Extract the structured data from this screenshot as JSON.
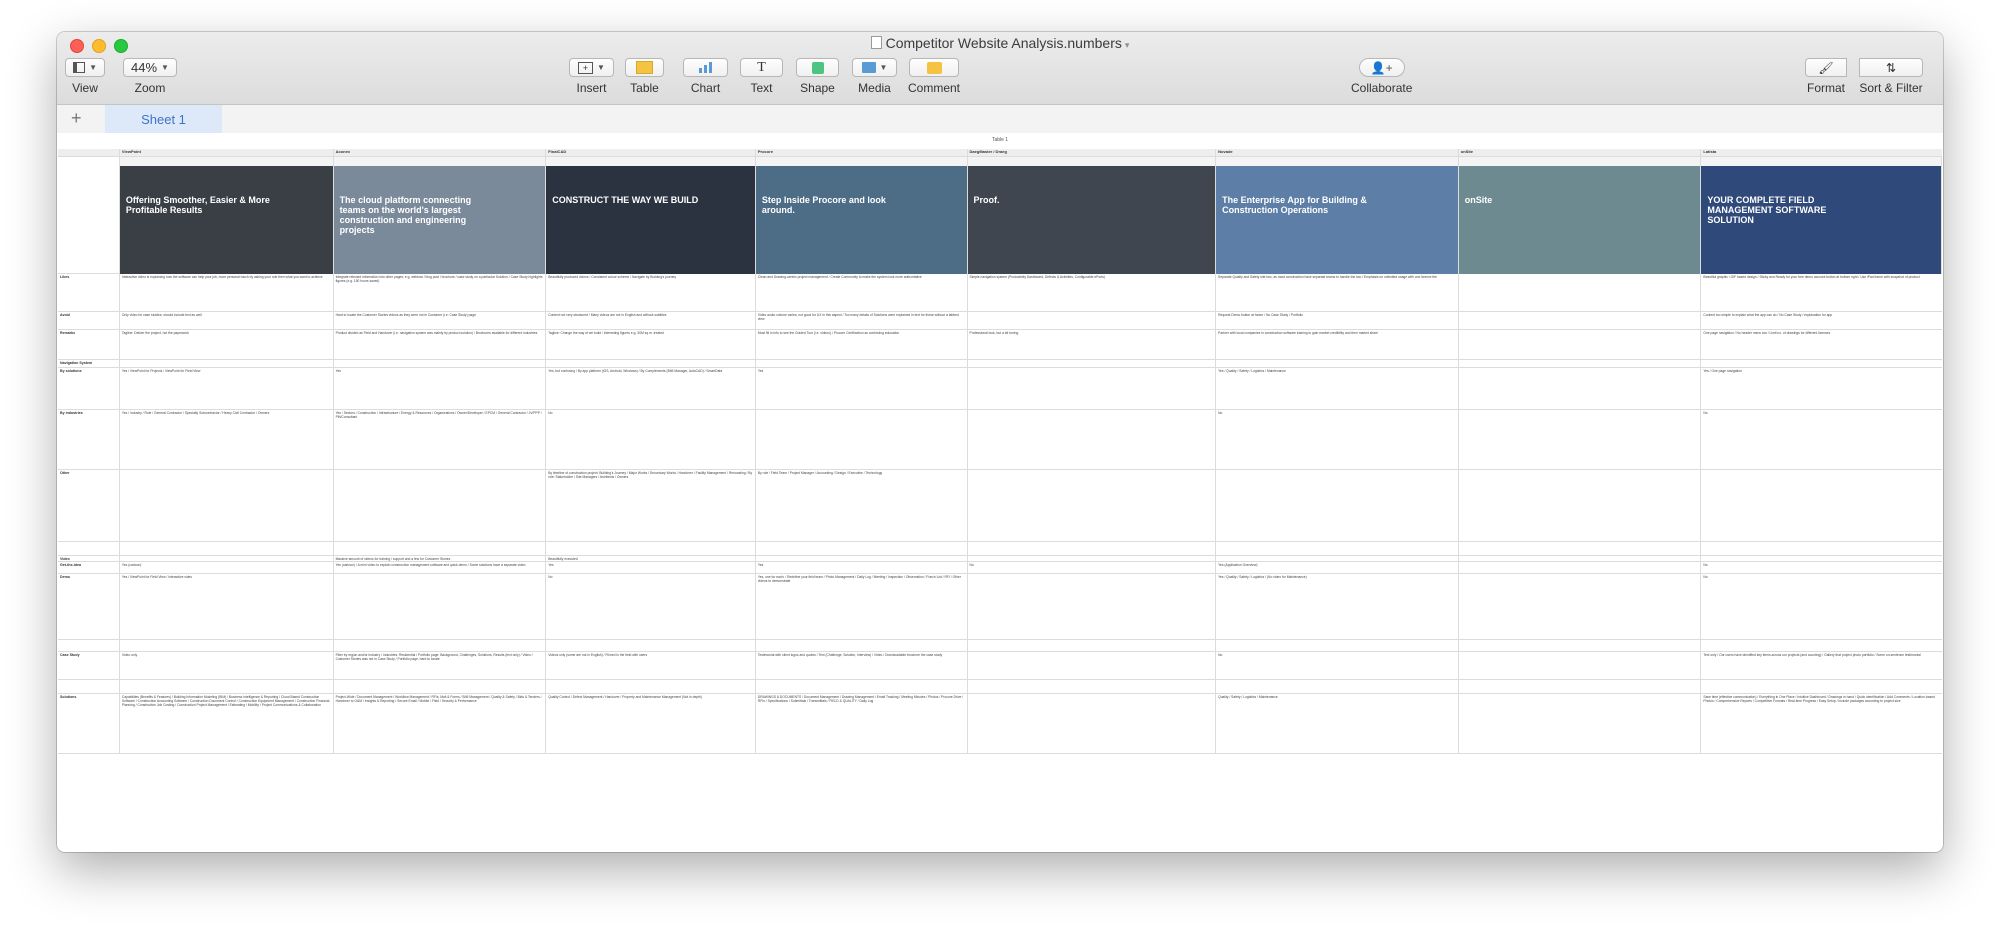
{
  "window": {
    "title": "Competitor Website Analysis.numbers"
  },
  "toolbar": {
    "view": "View",
    "zoom_label": "Zoom",
    "zoom_value": "44%",
    "insert": "Insert",
    "table": "Table",
    "chart": "Chart",
    "text": "Text",
    "shape": "Shape",
    "media": "Media",
    "comment": "Comment",
    "collaborate": "Collaborate",
    "format": "Format",
    "sort_filter": "Sort & Filter"
  },
  "sheet": {
    "tab": "Sheet 1",
    "table_title": "Table 1"
  },
  "colors": {
    "accent": "#3c74c8",
    "tab_bg": "#dde9f9",
    "insert_icon": "#f5c342",
    "shape_icon": "#4cc583",
    "media_icon": "#5b9bd5"
  },
  "columns": [
    "",
    "ViewPoint",
    "Aconex",
    "FinalCAD",
    "Procore",
    "DaegMaster / Draeg",
    "Novade",
    "onSite",
    "Latista"
  ],
  "screenshots": [
    {
      "text": "Offering Smoother, Easier & More Profitable Results",
      "color": "#3a3f46"
    },
    {
      "text": "The cloud platform connecting teams on the world's largest construction and engineering projects",
      "color": "#7a8a9a"
    },
    {
      "text": "CONSTRUCT THE WAY WE BUILD",
      "color": "#2b3340"
    },
    {
      "text": "Step Inside Procore and look around.",
      "color": "#4d6c86"
    },
    {
      "text": "Proof.",
      "color": "#3f4650"
    },
    {
      "text": "The Enterprise App for Building & Construction Operations",
      "color": "#5d7ea7"
    },
    {
      "text": "onSite",
      "color": "#6d8a90"
    },
    {
      "text": "YOUR COMPLETE FIELD MANAGEMENT SOFTWARE SOLUTION",
      "color": "#2f4a7a"
    }
  ],
  "rows": [
    {
      "label": "Likes",
      "cells": [
        "Interactive video is explaining how the software can help your job, more personal touch by asking your role then what you want to achieve",
        "Integrate relevant information into other pages; e.g. webinar / blog post / brochure / case study on a particular Solution / Case Study highlights figures (e.g. 150 hours saved)",
        "Beautifully produced videos / Consistent colour scheme / Navigate by Building's journey",
        "Clean and Drawing-centric project management / Create Community to make the system look more authoritative",
        "Simple navigation system (Productivity Dashboard, Defects & Activities, Configurable ePorts)",
        "Separate Quality and Safety site two, as most construction have separate teams to handle the two / Emphasis on unlimited usage with one licence fee",
        "",
        "Beautiful graphic / GIF based design / Sticky and Ready for your free demo account button at bottom right / Use iPad frame with snapshot of product",
        ""
      ]
    },
    {
      "label": "Avoid",
      "cells": [
        "Only video for case studies; should include text as well",
        "Hard to locate the Customer Stories videos as they were not in Customer (i.e. Case Study) page",
        "Content not very structured / Many videos are not in English and without subtitles",
        "Video audio volume varies; not good for UX in this aspect / Too many details of Solutions were explained in text for those without a tabbed view",
        "",
        "Request Demo button at footer / No Case Study / Portfolio",
        "",
        "Content too simple to explain what the app can do / No Case Study / explanation for app",
        "Text oriented content"
      ]
    },
    {
      "label": "Remarks",
      "cells": [
        "Tagline: Deliver the project, not the paperwork",
        "Product divided as Field and Handover (i.e. navigation system was mainly by product solution) / Brochures available for different industries",
        "Tagline: Change the way of we build / Interesting figures e.g. 30M sq.m. treated",
        "Must fill in info to see the Guided Tour (i.e. videos) / Procore Certification as continuing education",
        "Professional look, but a bit boring",
        "Partner with local companies in construction software training to gain market credibility and then market share",
        "",
        "One page navigation / No header menu bar / Limit no. of drawings for different licenses",
        ""
      ]
    },
    {
      "label": "Navigation System",
      "section": true,
      "cells": [
        "",
        "",
        "",
        "",
        "",
        "",
        "",
        "",
        ""
      ]
    },
    {
      "label": "By solutions",
      "cells": [
        "Yes / ViewPoint for Projects / ViewPoint for Field View",
        "Yes",
        "Yes, but confusing / By app platform (iOS, Android, Windows) / By Complements (BIM Manager, AutoCAD) / SmartData",
        "Yes",
        "",
        "Yes / Quality / Safety / Logistics / Maintenance",
        "",
        "Yes / One page navigation",
        "Yes / Features / Solutions"
      ]
    },
    {
      "label": "By industries",
      "cells": [
        "Yes / Industry / Role / General Contractor / Specialty Subcontractor / Heavy Civil Contractor / Owners",
        "Yes / Sectors / Construction / Infrastructure / Energy & Resources / Organizations / Owner/Developer / EPCM / General Contractor / JV/PPP / PM/Consultant",
        "No",
        "",
        "",
        "No",
        "",
        "No",
        ""
      ]
    },
    {
      "label": "Other",
      "cells": [
        "",
        "",
        "By timeline of construction project: Building's Journey / Major Works / Secondary Works / Handover / Facility Management / Renovating / By role: Stakeholder / Site Managers / Architects / Owners",
        "By role / Field Team / Project Manager / Accounting / Design / Executive / Technology",
        "",
        "",
        "",
        "",
        ""
      ]
    },
    {
      "label": "",
      "cells": [
        "",
        "",
        "",
        "",
        "",
        "",
        "",
        "",
        ""
      ]
    },
    {
      "label": "Video",
      "cells": [
        "",
        "Massive amount of videos for training / support and a few for Customer Stories",
        "Beautifully executed",
        "",
        "",
        "",
        "",
        "",
        ""
      ]
    },
    {
      "label": "Get-the-idea",
      "cells": [
        "Yes (cartoon)",
        "Yes (cartoon) / A mini video to explain construction management software and quick demo / Some solutions have a separate video",
        "Yes",
        "Yes",
        "No",
        "Yes (Application Overview)",
        "",
        "No",
        ""
      ]
    },
    {
      "label": "Demo",
      "cells": [
        "Yes / ViewPoint for Field View / Interactive video",
        "",
        "No",
        "Yes, one for each: / Redefine your field team / Photo Management / Daily Log / Meeting / Inspection / Observation / Punch List / RFI / Other videos to demonstrate",
        "",
        "Yes / Quality / Safety / Logistics / (No video for Maintenance)",
        "",
        "No",
        ""
      ]
    },
    {
      "label": "",
      "cells": [
        "",
        "",
        "",
        "",
        "",
        "",
        "",
        "",
        ""
      ]
    },
    {
      "label": "Case Study",
      "cells": [
        "Video only",
        "Filter by region and/or industry / Industries: Residential / Portfolio page: Background, Challenges, Solutions, Results (text only) / Video / Customer Stories was not in Case Study / Portfolio page, hard to locate",
        "Videos only (some are not in English) / Filmed in the field with users",
        "Testimonial with client logos and quotes / Text (Challenge, Solution, Interview) / Video / Downloadable brochure the case study",
        "",
        "No",
        "",
        "Text only / Our users have identified key items across our projects (and counting) / Gallery that project photo portfolio / Some on-sentence testimonial",
        ""
      ]
    },
    {
      "label": "",
      "cells": [
        "",
        "",
        "",
        "",
        "",
        "",
        "",
        "",
        ""
      ]
    },
    {
      "label": "Solutions",
      "cells": [
        "Capabilities (Benefits & Features) / Building Information Modeling (BIM) / Business Intelligence & Reporting / Cloud Based Construction Software / Construction Accounting Software / Construction Document Control / Construction Equipment Management / Construction Financial Planning / Construction Job Costing / Construction Project Management / Estimating / Mobility / Project Communications & Collaboration",
        "Project-Wide / Document Management / Workflow Management / RFIs, Mail & Forms / BIM Management / Quality & Safety / Bids & Tenders / Handover to O&M / Insights & Reporting / Secure Email / Mobile / Field / Security & Performance",
        "Quality Control / Defect Management / Handover / Property and Maintenance Management (Not in depth)",
        "DRAWINGS & DOCUMENTS / Document Management / Drawing Management / Email Tracking / Meeting Minutes / Photos / Procore Drive / RFIs / Specifications / Submittals / Transmittals / FIELD & QUALITY / Daily Log",
        "",
        "Quality / Safety / Logistics / Maintenance",
        "",
        "Save time (effective communication) / Everything in One Place / Intuitive Dashboard / Drawings in hand / Quick identification / Add Comments / Location-based Photos / Comprehensive Reports / Competitive Formats / Real-time Progress / Easy Setup / Include packages according to project size",
        ""
      ]
    }
  ]
}
